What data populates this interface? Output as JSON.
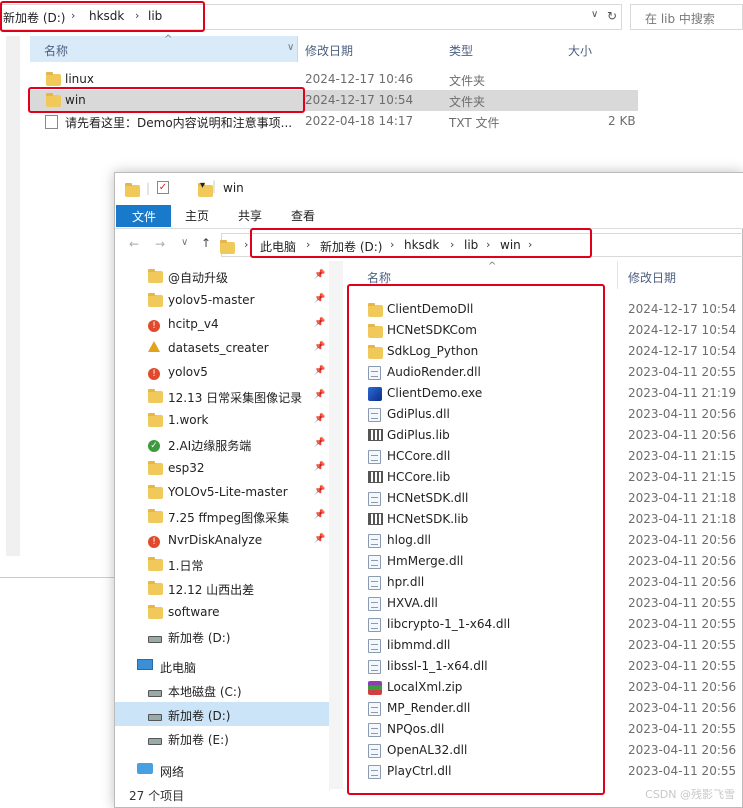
{
  "back_window": {
    "breadcrumb": [
      "新加卷 (D:)",
      "hksdk",
      "lib"
    ],
    "search_placeholder": "在 lib 中搜索",
    "columns": {
      "name": "名称",
      "modified": "修改日期",
      "type": "类型",
      "size": "大小"
    },
    "rows": [
      {
        "name": "linux",
        "date": "2024-12-17 10:46",
        "type": "文件夹",
        "size": ""
      },
      {
        "name": "win",
        "date": "2024-12-17 10:54",
        "type": "文件夹",
        "size": ""
      },
      {
        "name": "请先看这里：Demo内容说明和注意事项...",
        "date": "2022-04-18 14:17",
        "type": "TXT 文件",
        "size": "2 KB"
      }
    ]
  },
  "front_window": {
    "title": "win",
    "ribbon_tabs": [
      "文件",
      "主页",
      "共享",
      "查看"
    ],
    "breadcrumb": [
      "此电脑",
      "新加卷 (D:)",
      "hksdk",
      "lib",
      "win"
    ],
    "nav_items": [
      {
        "label": "@自动升级",
        "icon": "folder"
      },
      {
        "label": "yolov5-master",
        "icon": "folder"
      },
      {
        "label": "hcitp_v4",
        "icon": "error-folder"
      },
      {
        "label": "datasets_creater",
        "icon": "warning-folder"
      },
      {
        "label": "yolov5",
        "icon": "error-folder"
      },
      {
        "label": "12.13 日常采集图像记录",
        "icon": "folder"
      },
      {
        "label": "1.work",
        "icon": "folder"
      },
      {
        "label": "2.AI边缘服务端",
        "icon": "synced-folder"
      },
      {
        "label": "esp32",
        "icon": "folder"
      },
      {
        "label": "YOLOv5-Lite-master",
        "icon": "folder"
      },
      {
        "label": "7.25 ffmpeg图像采集",
        "icon": "folder"
      },
      {
        "label": "NvrDiskAnalyze",
        "icon": "error-folder"
      },
      {
        "label": "1.日常",
        "icon": "folder"
      },
      {
        "label": "12.12 山西出差",
        "icon": "folder"
      },
      {
        "label": "software",
        "icon": "folder"
      },
      {
        "label": "新加卷 (D:)",
        "icon": "drive"
      },
      {
        "label": "此电脑",
        "icon": "computer"
      },
      {
        "label": "本地磁盘 (C:)",
        "icon": "drive"
      },
      {
        "label": "新加卷 (D:)",
        "icon": "drive"
      },
      {
        "label": "新加卷 (E:)",
        "icon": "drive"
      },
      {
        "label": "网络",
        "icon": "network"
      }
    ],
    "columns": {
      "name": "名称",
      "modified": "修改日期"
    },
    "files": [
      {
        "name": "ClientDemoDll",
        "date": "2024-12-17 10:54",
        "icon": "folder"
      },
      {
        "name": "HCNetSDKCom",
        "date": "2024-12-17 10:54",
        "icon": "folder"
      },
      {
        "name": "SdkLog_Python",
        "date": "2024-12-17 10:54",
        "icon": "folder"
      },
      {
        "name": "AudioRender.dll",
        "date": "2023-04-11 20:55",
        "icon": "dll"
      },
      {
        "name": "ClientDemo.exe",
        "date": "2023-04-11 21:19",
        "icon": "exe"
      },
      {
        "name": "GdiPlus.dll",
        "date": "2023-04-11 20:56",
        "icon": "dll"
      },
      {
        "name": "GdiPlus.lib",
        "date": "2023-04-11 20:56",
        "icon": "lib"
      },
      {
        "name": "HCCore.dll",
        "date": "2023-04-11 21:15",
        "icon": "dll"
      },
      {
        "name": "HCCore.lib",
        "date": "2023-04-11 21:15",
        "icon": "lib"
      },
      {
        "name": "HCNetSDK.dll",
        "date": "2023-04-11 21:18",
        "icon": "dll"
      },
      {
        "name": "HCNetSDK.lib",
        "date": "2023-04-11 21:18",
        "icon": "lib"
      },
      {
        "name": "hlog.dll",
        "date": "2023-04-11 20:56",
        "icon": "dll"
      },
      {
        "name": "HmMerge.dll",
        "date": "2023-04-11 20:56",
        "icon": "dll"
      },
      {
        "name": "hpr.dll",
        "date": "2023-04-11 20:56",
        "icon": "dll"
      },
      {
        "name": "HXVA.dll",
        "date": "2023-04-11 20:55",
        "icon": "dll"
      },
      {
        "name": "libcrypto-1_1-x64.dll",
        "date": "2023-04-11 20:55",
        "icon": "dll"
      },
      {
        "name": "libmmd.dll",
        "date": "2023-04-11 20:55",
        "icon": "dll"
      },
      {
        "name": "libssl-1_1-x64.dll",
        "date": "2023-04-11 20:55",
        "icon": "dll"
      },
      {
        "name": "LocalXml.zip",
        "date": "2023-04-11 20:56",
        "icon": "zip"
      },
      {
        "name": "MP_Render.dll",
        "date": "2023-04-11 20:56",
        "icon": "dll"
      },
      {
        "name": "NPQos.dll",
        "date": "2023-04-11 20:55",
        "icon": "dll"
      },
      {
        "name": "OpenAL32.dll",
        "date": "2023-04-11 20:56",
        "icon": "dll"
      },
      {
        "name": "PlayCtrl.dll",
        "date": "2023-04-11 20:55",
        "icon": "dll"
      }
    ],
    "status": "27 个项目"
  },
  "watermark": "CSDN @残影飞雪",
  "colors": {
    "highlight_red": "#e0001b",
    "ribbon_blue": "#1979ca",
    "selection": "#cce4f7"
  }
}
